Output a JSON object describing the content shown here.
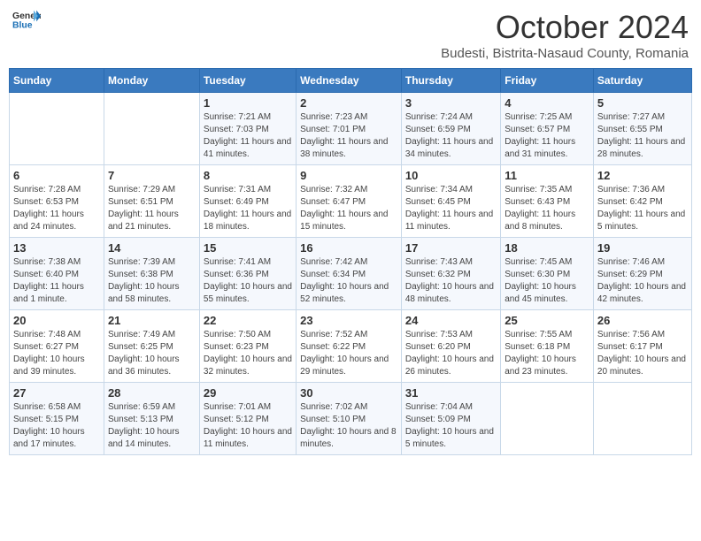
{
  "logo": {
    "line1": "General",
    "line2": "Blue"
  },
  "title": "October 2024",
  "subtitle": "Budesti, Bistrita-Nasaud County, Romania",
  "days_of_week": [
    "Sunday",
    "Monday",
    "Tuesday",
    "Wednesday",
    "Thursday",
    "Friday",
    "Saturday"
  ],
  "weeks": [
    [
      {
        "day": "",
        "info": ""
      },
      {
        "day": "",
        "info": ""
      },
      {
        "day": "1",
        "info": "Sunrise: 7:21 AM\nSunset: 7:03 PM\nDaylight: 11 hours and 41 minutes."
      },
      {
        "day": "2",
        "info": "Sunrise: 7:23 AM\nSunset: 7:01 PM\nDaylight: 11 hours and 38 minutes."
      },
      {
        "day": "3",
        "info": "Sunrise: 7:24 AM\nSunset: 6:59 PM\nDaylight: 11 hours and 34 minutes."
      },
      {
        "day": "4",
        "info": "Sunrise: 7:25 AM\nSunset: 6:57 PM\nDaylight: 11 hours and 31 minutes."
      },
      {
        "day": "5",
        "info": "Sunrise: 7:27 AM\nSunset: 6:55 PM\nDaylight: 11 hours and 28 minutes."
      }
    ],
    [
      {
        "day": "6",
        "info": "Sunrise: 7:28 AM\nSunset: 6:53 PM\nDaylight: 11 hours and 24 minutes."
      },
      {
        "day": "7",
        "info": "Sunrise: 7:29 AM\nSunset: 6:51 PM\nDaylight: 11 hours and 21 minutes."
      },
      {
        "day": "8",
        "info": "Sunrise: 7:31 AM\nSunset: 6:49 PM\nDaylight: 11 hours and 18 minutes."
      },
      {
        "day": "9",
        "info": "Sunrise: 7:32 AM\nSunset: 6:47 PM\nDaylight: 11 hours and 15 minutes."
      },
      {
        "day": "10",
        "info": "Sunrise: 7:34 AM\nSunset: 6:45 PM\nDaylight: 11 hours and 11 minutes."
      },
      {
        "day": "11",
        "info": "Sunrise: 7:35 AM\nSunset: 6:43 PM\nDaylight: 11 hours and 8 minutes."
      },
      {
        "day": "12",
        "info": "Sunrise: 7:36 AM\nSunset: 6:42 PM\nDaylight: 11 hours and 5 minutes."
      }
    ],
    [
      {
        "day": "13",
        "info": "Sunrise: 7:38 AM\nSunset: 6:40 PM\nDaylight: 11 hours and 1 minute."
      },
      {
        "day": "14",
        "info": "Sunrise: 7:39 AM\nSunset: 6:38 PM\nDaylight: 10 hours and 58 minutes."
      },
      {
        "day": "15",
        "info": "Sunrise: 7:41 AM\nSunset: 6:36 PM\nDaylight: 10 hours and 55 minutes."
      },
      {
        "day": "16",
        "info": "Sunrise: 7:42 AM\nSunset: 6:34 PM\nDaylight: 10 hours and 52 minutes."
      },
      {
        "day": "17",
        "info": "Sunrise: 7:43 AM\nSunset: 6:32 PM\nDaylight: 10 hours and 48 minutes."
      },
      {
        "day": "18",
        "info": "Sunrise: 7:45 AM\nSunset: 6:30 PM\nDaylight: 10 hours and 45 minutes."
      },
      {
        "day": "19",
        "info": "Sunrise: 7:46 AM\nSunset: 6:29 PM\nDaylight: 10 hours and 42 minutes."
      }
    ],
    [
      {
        "day": "20",
        "info": "Sunrise: 7:48 AM\nSunset: 6:27 PM\nDaylight: 10 hours and 39 minutes."
      },
      {
        "day": "21",
        "info": "Sunrise: 7:49 AM\nSunset: 6:25 PM\nDaylight: 10 hours and 36 minutes."
      },
      {
        "day": "22",
        "info": "Sunrise: 7:50 AM\nSunset: 6:23 PM\nDaylight: 10 hours and 32 minutes."
      },
      {
        "day": "23",
        "info": "Sunrise: 7:52 AM\nSunset: 6:22 PM\nDaylight: 10 hours and 29 minutes."
      },
      {
        "day": "24",
        "info": "Sunrise: 7:53 AM\nSunset: 6:20 PM\nDaylight: 10 hours and 26 minutes."
      },
      {
        "day": "25",
        "info": "Sunrise: 7:55 AM\nSunset: 6:18 PM\nDaylight: 10 hours and 23 minutes."
      },
      {
        "day": "26",
        "info": "Sunrise: 7:56 AM\nSunset: 6:17 PM\nDaylight: 10 hours and 20 minutes."
      }
    ],
    [
      {
        "day": "27",
        "info": "Sunrise: 6:58 AM\nSunset: 5:15 PM\nDaylight: 10 hours and 17 minutes."
      },
      {
        "day": "28",
        "info": "Sunrise: 6:59 AM\nSunset: 5:13 PM\nDaylight: 10 hours and 14 minutes."
      },
      {
        "day": "29",
        "info": "Sunrise: 7:01 AM\nSunset: 5:12 PM\nDaylight: 10 hours and 11 minutes."
      },
      {
        "day": "30",
        "info": "Sunrise: 7:02 AM\nSunset: 5:10 PM\nDaylight: 10 hours and 8 minutes."
      },
      {
        "day": "31",
        "info": "Sunrise: 7:04 AM\nSunset: 5:09 PM\nDaylight: 10 hours and 5 minutes."
      },
      {
        "day": "",
        "info": ""
      },
      {
        "day": "",
        "info": ""
      }
    ]
  ]
}
